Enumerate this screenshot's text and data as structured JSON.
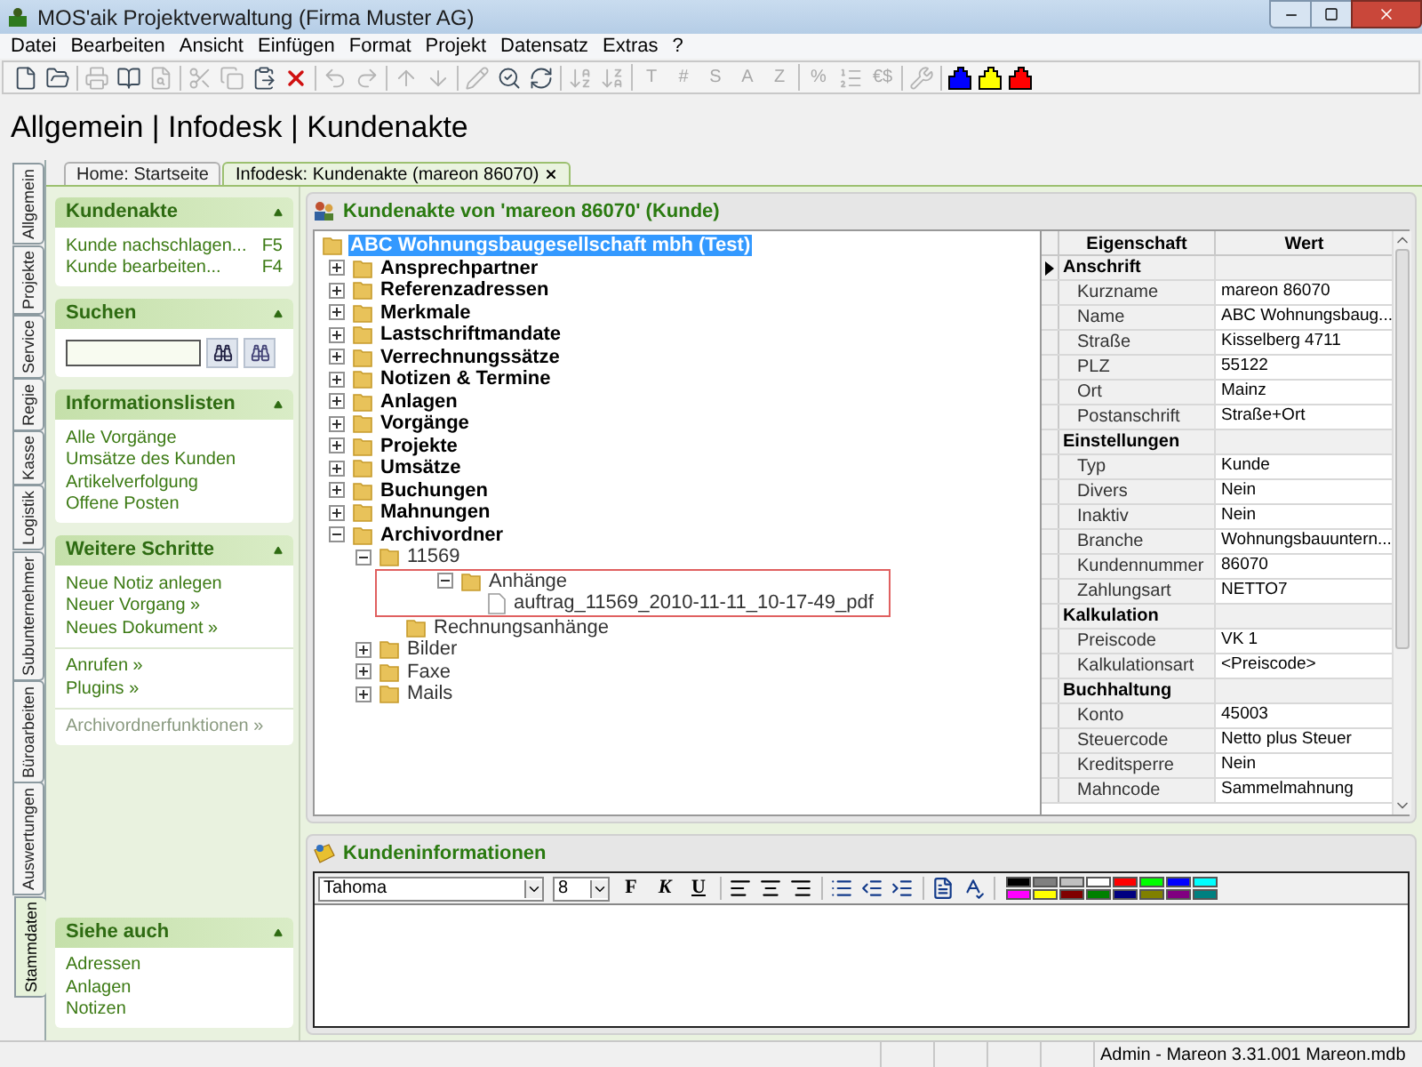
{
  "window": {
    "title": "MOS'aik Projektverwaltung (Firma Muster AG)"
  },
  "menu": [
    "Datei",
    "Bearbeiten",
    "Ansicht",
    "Einfügen",
    "Format",
    "Projekt",
    "Datensatz",
    "Extras",
    "?"
  ],
  "toolbar": [
    [
      {
        "kind": "icon",
        "disabled": false
      },
      {
        "kind": "icon",
        "disabled": false
      }
    ],
    [
      {
        "kind": "icon",
        "disabled": true
      },
      {
        "kind": "icon",
        "disabled": false
      },
      {
        "kind": "icon",
        "disabled": true
      }
    ],
    [
      {
        "kind": "icon",
        "disabled": true
      },
      {
        "kind": "icon",
        "disabled": true
      },
      {
        "kind": "icon",
        "disabled": false
      },
      {
        "kind": "icon",
        "disabled": false
      }
    ],
    [
      {
        "kind": "icon",
        "disabled": true
      },
      {
        "kind": "icon",
        "disabled": true
      }
    ],
    [
      {
        "kind": "icon",
        "disabled": true
      },
      {
        "kind": "icon",
        "disabled": true
      }
    ],
    [
      {
        "kind": "icon",
        "disabled": true
      },
      {
        "kind": "icon",
        "disabled": false
      },
      {
        "kind": "icon",
        "disabled": false
      }
    ],
    [
      {
        "kind": "icon",
        "disabled": true
      },
      {
        "kind": "icon",
        "disabled": true
      }
    ],
    [
      {
        "kind": "letter",
        "text": "T",
        "disabled": true
      },
      {
        "kind": "letter",
        "text": "#",
        "disabled": true
      },
      {
        "kind": "letter",
        "text": "S",
        "disabled": true
      },
      {
        "kind": "letter",
        "text": "A",
        "disabled": true
      },
      {
        "kind": "letter",
        "text": "Z",
        "disabled": true
      }
    ],
    [
      {
        "kind": "letter",
        "text": "%",
        "disabled": true
      },
      {
        "kind": "icon",
        "disabled": true
      },
      {
        "kind": "letter",
        "text": "€$",
        "disabled": true
      }
    ],
    [
      {
        "kind": "icon",
        "disabled": true
      }
    ],
    [
      {
        "kind": "puzzle",
        "color": "#0000ff"
      },
      {
        "kind": "puzzle",
        "color": "#ffff00"
      },
      {
        "kind": "puzzle",
        "color": "#ff0000"
      }
    ]
  ],
  "heading": "Allgemein | Infodesk | Kundenakte",
  "doc_tabs": [
    {
      "label": "Home: Startseite",
      "selected": false,
      "closable": false
    },
    {
      "label": "Infodesk: Kundenakte (mareon 86070)",
      "selected": true,
      "closable": true
    }
  ],
  "side_tabs": [
    {
      "label": "Allgemein",
      "selected": false
    },
    {
      "label": "Projekte",
      "selected": false
    },
    {
      "label": "Service",
      "selected": false
    },
    {
      "label": "Regie",
      "selected": false
    },
    {
      "label": "Kasse",
      "selected": false
    },
    {
      "label": "Logistik",
      "selected": false
    },
    {
      "label": "Subunternehmer",
      "selected": false
    },
    {
      "label": "Büroarbeiten",
      "selected": false
    },
    {
      "label": "Auswertungen",
      "selected": false
    },
    {
      "label": "Stammdaten",
      "selected": true
    }
  ],
  "sidebar": {
    "panels": [
      {
        "title": "Kundenakte",
        "kind": "links",
        "groups": [
          [
            {
              "label": "Kunde nachschlagen...",
              "shortcut": "F5",
              "disabled": false
            },
            {
              "label": "Kunde bearbeiten...",
              "shortcut": "F4",
              "disabled": false
            }
          ]
        ]
      },
      {
        "title": "Suchen",
        "kind": "search"
      },
      {
        "title": "Informationslisten",
        "kind": "links",
        "groups": [
          [
            {
              "label": "Alle Vorgänge",
              "disabled": false
            },
            {
              "label": "Umsätze des Kunden",
              "disabled": false
            },
            {
              "label": "Artikelverfolgung",
              "disabled": false
            },
            {
              "label": "Offene Posten",
              "disabled": false
            }
          ]
        ]
      },
      {
        "title": "Weitere Schritte",
        "kind": "links",
        "groups": [
          [
            {
              "label": "Neue Notiz anlegen",
              "disabled": false
            },
            {
              "label": "Neuer Vorgang »",
              "disabled": false
            },
            {
              "label": "Neues Dokument »",
              "disabled": false
            }
          ],
          [
            {
              "label": "Anrufen »",
              "disabled": false
            },
            {
              "label": "Plugins »",
              "disabled": false
            }
          ],
          [
            {
              "label": "Archivordnerfunktionen »",
              "disabled": true
            }
          ]
        ]
      }
    ],
    "footer_panel": {
      "title": "Siehe auch",
      "kind": "links",
      "groups": [
        [
          {
            "label": "Adressen",
            "disabled": false
          },
          {
            "label": "Anlagen",
            "disabled": false
          },
          {
            "label": "Notizen",
            "disabled": false
          }
        ]
      ]
    }
  },
  "record_panel": {
    "title": "Kundenakte von 'mareon 86070' (Kunde)",
    "tree": {
      "label": "ABC Wohnungsbaugesellschaft mbh (Test)",
      "kind": "folder",
      "selected": true,
      "children": [
        {
          "label": "Ansprechpartner",
          "kind": "folder",
          "expanded": false,
          "selected": false
        },
        {
          "label": "Referenzadressen",
          "kind": "folder",
          "expanded": false,
          "selected": false
        },
        {
          "label": "Merkmale",
          "kind": "folder",
          "expanded": false,
          "selected": false
        },
        {
          "label": "Lastschriftmandate",
          "kind": "folder",
          "expanded": false,
          "selected": false
        },
        {
          "label": "Verrechnungssätze",
          "kind": "folder",
          "expanded": false,
          "selected": false
        },
        {
          "label": "Notizen & Termine",
          "kind": "folder",
          "expanded": false,
          "selected": false
        },
        {
          "label": "Anlagen",
          "kind": "folder",
          "expanded": false,
          "selected": false
        },
        {
          "label": "Vorgänge",
          "kind": "folder",
          "expanded": false,
          "selected": false
        },
        {
          "label": "Projekte",
          "kind": "folder",
          "expanded": false,
          "selected": false
        },
        {
          "label": "Umsätze",
          "kind": "folder",
          "expanded": false,
          "selected": false
        },
        {
          "label": "Buchungen",
          "kind": "folder",
          "expanded": false,
          "selected": false
        },
        {
          "label": "Mahnungen",
          "kind": "folder",
          "expanded": false,
          "selected": false
        },
        {
          "label": "Archivordner",
          "kind": "folder",
          "expanded": true,
          "selected": false,
          "children": [
            {
              "label": "11569",
              "kind": "folder",
              "expanded": true,
              "selected": false,
              "children": [
                {
                  "label": "Anhänge",
                  "kind": "folder",
                  "expanded": true,
                  "selected": false,
                  "highlighted": true,
                  "children": [
                    {
                      "label": "auftrag_11569_2010-11-11_10-17-49_pdf",
                      "kind": "file",
                      "selected": false
                    }
                  ]
                },
                {
                  "label": "Rechnungsanhänge",
                  "kind": "folder",
                  "selected": false
                }
              ]
            },
            {
              "label": "Bilder",
              "kind": "folder",
              "expanded": false,
              "selected": false
            },
            {
              "label": "Faxe",
              "kind": "folder",
              "expanded": false,
              "selected": false
            },
            {
              "label": "Mails",
              "kind": "folder",
              "expanded": false,
              "selected": false
            }
          ]
        }
      ]
    },
    "properties": {
      "columns": [
        "Eigenschaft",
        "Wert"
      ],
      "groups": [
        {
          "name": "Anschrift",
          "current": true,
          "rows": [
            {
              "name": "Kurzname",
              "value": "mareon 86070"
            },
            {
              "name": "Name",
              "value": "ABC Wohnungsbaug..."
            },
            {
              "name": "Straße",
              "value": "Kisselberg 4711"
            },
            {
              "name": "PLZ",
              "value": "55122"
            },
            {
              "name": "Ort",
              "value": "Mainz"
            },
            {
              "name": "Postanschrift",
              "value": "Straße+Ort"
            }
          ]
        },
        {
          "name": "Einstellungen",
          "current": false,
          "rows": [
            {
              "name": "Typ",
              "value": "Kunde"
            },
            {
              "name": "Divers",
              "value": "Nein"
            },
            {
              "name": "Inaktiv",
              "value": "Nein"
            },
            {
              "name": "Branche",
              "value": "Wohnungsbauuntern..."
            },
            {
              "name": "Kundennummer",
              "value": "86070"
            },
            {
              "name": "Zahlungsart",
              "value": "NETTO7"
            }
          ]
        },
        {
          "name": "Kalkulation",
          "current": false,
          "rows": [
            {
              "name": "Preiscode",
              "value": "VK 1"
            },
            {
              "name": "Kalkulationsart",
              "value": "<Preiscode>"
            }
          ]
        },
        {
          "name": "Buchhaltung",
          "current": false,
          "rows": [
            {
              "name": "Konto",
              "value": "45003"
            },
            {
              "name": "Steuercode",
              "value": "Netto plus Steuer"
            },
            {
              "name": "Kreditsperre",
              "value": "Nein"
            },
            {
              "name": "Mahncode",
              "value": "Sammelmahnung"
            }
          ]
        }
      ]
    }
  },
  "info_panel": {
    "title": "Kundeninformationen",
    "font": "Tahoma",
    "size": "8",
    "format_buttons": [
      {
        "text": "F",
        "kind": "bold"
      },
      {
        "text": "K",
        "kind": "italic"
      },
      {
        "text": "U",
        "kind": "underline"
      }
    ],
    "colors": [
      {
        "color": "#000000"
      },
      {
        "color": "#808080"
      },
      {
        "color": "#c0c0c0"
      },
      {
        "color": "#ffffff"
      },
      {
        "color": "#ff0000"
      },
      {
        "color": "#00ff00"
      },
      {
        "color": "#0000ff"
      },
      {
        "color": "#00ffff"
      },
      {
        "color": "#ff00ff"
      },
      {
        "color": "#ffff00"
      },
      {
        "color": "#800000"
      },
      {
        "color": "#008000"
      },
      {
        "color": "#000080"
      },
      {
        "color": "#808000"
      },
      {
        "color": "#800080"
      },
      {
        "color": "#008080"
      }
    ]
  },
  "status_bar": {
    "text": "Admin - Mareon 3.31.001 Mareon.mdb"
  }
}
